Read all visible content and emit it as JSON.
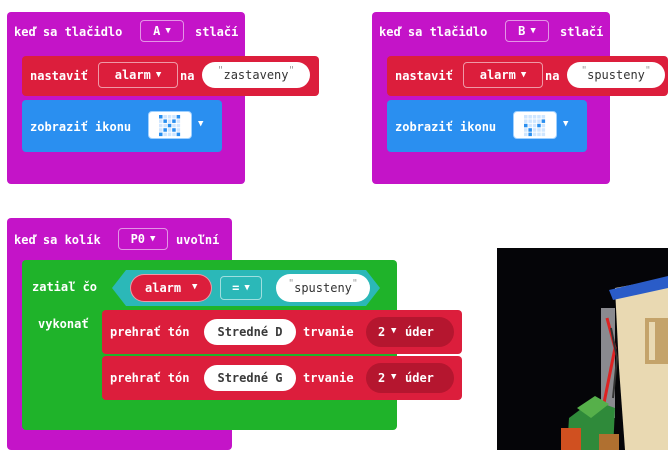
{
  "block_a": {
    "hat_prefix": "keď sa tlačidlo",
    "button": "A",
    "hat_suffix": "stlačí",
    "set_label": "nastaviť",
    "variable": "alarm",
    "to_label": "na",
    "value": "zastaveny",
    "show_label": "zobraziť ikonu"
  },
  "block_b": {
    "hat_prefix": "keď sa tlačidlo",
    "button": "B",
    "hat_suffix": "stlačí",
    "set_label": "nastaviť",
    "variable": "alarm",
    "to_label": "na",
    "value": "spusteny",
    "show_label": "zobraziť ikonu"
  },
  "block_pin": {
    "hat_prefix": "keď sa kolík",
    "pin": "P0",
    "hat_suffix": "uvoľní",
    "while_label": "zatiaľ čo",
    "do_label": "vykonať",
    "variable": "alarm",
    "operator": "=",
    "compare_value": "spusteny",
    "tone1": {
      "label": "prehrať tón",
      "note": "Stredné D",
      "duration_label": "trvanie",
      "beats": "2",
      "unit": "úder"
    },
    "tone2": {
      "label": "prehrať tón",
      "note": "Stredné G",
      "duration_label": "trvanie",
      "beats": "2",
      "unit": "úder"
    }
  },
  "colors": {
    "event": "#c414c8",
    "variables": "#dc1e3c",
    "basic": "#2a8ff0",
    "loops": "#1fb32a",
    "logic": "#2bb8b8"
  },
  "icons": {
    "a": "x-icon",
    "b": "check-icon",
    "dropdown": "chevron-down-icon"
  }
}
